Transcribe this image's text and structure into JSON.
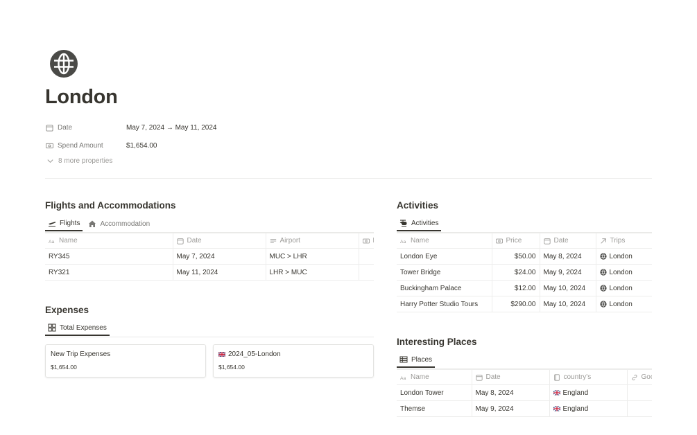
{
  "page": {
    "icon": "globe-icon",
    "title": "London",
    "properties": [
      {
        "icon": "calendar-icon",
        "name": "Date",
        "value": "May 7, 2024 → May 11, 2024"
      },
      {
        "icon": "money-icon",
        "name": "Spend Amount",
        "value": "$1,654.00"
      }
    ],
    "more_properties": "8 more properties"
  },
  "flights_section": {
    "title": "Flights and Accommodations",
    "tabs": [
      {
        "label": "Flights",
        "icon": "airplane-icon",
        "active": true
      },
      {
        "label": "Accommodation",
        "icon": "house-icon",
        "active": false
      }
    ],
    "columns": [
      {
        "icon": "text-icon",
        "label": "Name"
      },
      {
        "icon": "calendar-icon",
        "label": "Date"
      },
      {
        "icon": "list-icon",
        "label": "Airport"
      },
      {
        "icon": "money-icon",
        "label": "P"
      }
    ],
    "rows": [
      {
        "name": "RY345",
        "date": "May 7, 2024",
        "airport": "MUC > LHR"
      },
      {
        "name": "RY321",
        "date": "May 11, 2024",
        "airport": "LHR > MUC"
      }
    ]
  },
  "expenses_section": {
    "title": "Expenses",
    "tabs": [
      {
        "label": "Total Expenses",
        "icon": "gallery-icon",
        "active": true
      }
    ],
    "cards": [
      {
        "title": "New Trip Expenses",
        "amount": "$1,654.00",
        "flag": false
      },
      {
        "title": "2024_05-London",
        "amount": "$1,654.00",
        "flag": true
      }
    ]
  },
  "activities_section": {
    "title": "Activities",
    "tabs": [
      {
        "label": "Activities",
        "icon": "helicopter-icon",
        "active": true
      }
    ],
    "columns": [
      {
        "icon": "text-icon",
        "label": "Name"
      },
      {
        "icon": "money-icon",
        "label": "Price"
      },
      {
        "icon": "calendar-icon",
        "label": "Date"
      },
      {
        "icon": "arrow-up-right-icon",
        "label": "Trips"
      }
    ],
    "rows": [
      {
        "name": "London Eye",
        "price": "$50.00",
        "date": "May 8, 2024",
        "trip": "London"
      },
      {
        "name": "Tower Bridge",
        "price": "$24.00",
        "date": "May 9, 2024",
        "trip": "London"
      },
      {
        "name": "Buckingham Palace",
        "price": "$12.00",
        "date": "May 10, 2024",
        "trip": "London"
      },
      {
        "name": "Harry Potter Studio Tours",
        "price": "$290.00",
        "date": "May 10, 2024",
        "trip": "London"
      }
    ]
  },
  "places_section": {
    "title": "Interesting Places",
    "tabs": [
      {
        "label": "Places",
        "icon": "table-icon",
        "active": true
      }
    ],
    "columns": [
      {
        "icon": "text-icon",
        "label": "Name"
      },
      {
        "icon": "calendar-icon",
        "label": "Date"
      },
      {
        "icon": "book-icon",
        "label": "country's"
      },
      {
        "icon": "link-icon",
        "label": "Goo"
      }
    ],
    "rows": [
      {
        "name": "London Tower",
        "date": "May 8, 2024",
        "country": "England"
      },
      {
        "name": "Themse",
        "date": "May 9, 2024",
        "country": "England"
      }
    ]
  },
  "colors": {
    "text": "#37352f",
    "muted": "#787774",
    "border": "#ededec"
  }
}
